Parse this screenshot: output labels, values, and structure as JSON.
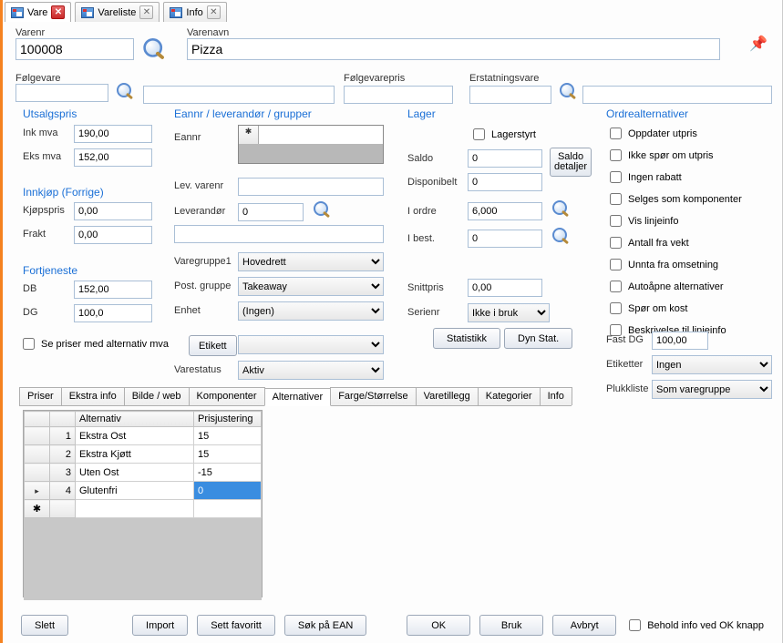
{
  "tabs": [
    {
      "label": "Vare",
      "active": true,
      "close_red": true
    },
    {
      "label": "Vareliste",
      "active": false,
      "close_red": false
    },
    {
      "label": "Info",
      "active": false,
      "close_red": false
    }
  ],
  "header": {
    "varenr_label": "Varenr",
    "varenr_value": "100008",
    "varenavn_label": "Varenavn",
    "varenavn_value": "Pizza",
    "folgevare_label": "Følgevare",
    "folgevarepris_label": "Følgevarepris",
    "erstatningsvare_label": "Erstatningsvare"
  },
  "utsalgspris": {
    "title": "Utsalgspris",
    "ink_mva_label": "Ink mva",
    "ink_mva_value": "190,00",
    "eks_mva_label": "Eks mva",
    "eks_mva_value": "152,00"
  },
  "innkjop": {
    "title": "Innkjøp (Forrige)",
    "kjopspris_label": "Kjøpspris",
    "kjopspris_value": "0,00",
    "frakt_label": "Frakt",
    "frakt_value": "0,00"
  },
  "fortjeneste": {
    "title": "Fortjeneste",
    "db_label": "DB",
    "db_value": "152,00",
    "dg_label": "DG",
    "dg_value": "100,0"
  },
  "alt_mva_label": "Se priser med alternativ mva",
  "ean": {
    "title": "Eannr / leverandør / grupper",
    "eannr_label": "Eannr",
    "lev_varenr_label": "Lev. varenr",
    "leverandor_label": "Leverandør",
    "leverandor_value": "0",
    "varegruppe1_label": "Varegruppe1",
    "varegruppe1_value": "Hovedrett",
    "post_gruppe_label": "Post. gruppe",
    "post_gruppe_value": "Takeaway",
    "enhet_label": "Enhet",
    "enhet_value": "(Ingen)",
    "etikett_label": "Etikett",
    "varestatus_label": "Varestatus",
    "varestatus_value": "Aktiv"
  },
  "lager": {
    "title": "Lager",
    "lagerstyrt_label": "Lagerstyrt",
    "saldo_label": "Saldo",
    "saldo_value": "0",
    "saldo_btn": "Saldo detaljer",
    "disponibelt_label": "Disponibelt",
    "disponibelt_value": "0",
    "iordre_label": "I ordre",
    "iordre_value": "6,000",
    "ibest_label": "I best.",
    "ibest_value": "0",
    "snittpris_label": "Snittpris",
    "snittpris_value": "0,00",
    "serienr_label": "Serienr",
    "serienr_value": "Ikke i bruk",
    "statistikk_btn": "Statistikk",
    "dyn_stat_btn": "Dyn Stat."
  },
  "ordrealt": {
    "title": "Ordrealternativer",
    "opts": [
      "Oppdater utpris",
      "Ikke spør om utpris",
      "Ingen rabatt",
      "Selges som komponenter",
      "Vis linjeinfo",
      "Antall fra vekt",
      "Unnta fra omsetning",
      "Autoåpne alternativer",
      "Spør om kost",
      "Beskrivelse til linjeinfo"
    ],
    "fast_dg_label": "Fast DG",
    "fast_dg_value": "100,00",
    "etiketter_label": "Etiketter",
    "etiketter_value": "Ingen",
    "plukkliste_label": "Plukkliste",
    "plukkliste_value": "Som varegruppe"
  },
  "subtabs": [
    "Priser",
    "Ekstra info",
    "Bilde / web",
    "Komponenter",
    "Alternativer",
    "Farge/Størrelse",
    "Varetillegg",
    "Kategorier",
    "Info"
  ],
  "subtab_active": 4,
  "alt_table": {
    "col_alternativ": "Alternativ",
    "col_pris": "Prisjustering",
    "rows": [
      {
        "n": "1",
        "alt": "Ekstra Ost",
        "pris": "15",
        "sel": false,
        "cursor": false
      },
      {
        "n": "2",
        "alt": "Ekstra Kjøtt",
        "pris": "15",
        "sel": false,
        "cursor": false
      },
      {
        "n": "3",
        "alt": "Uten Ost",
        "pris": "-15",
        "sel": false,
        "cursor": false
      },
      {
        "n": "4",
        "alt": "Glutenfri",
        "pris": "0",
        "sel": true,
        "cursor": true
      }
    ]
  },
  "footer": {
    "slett": "Slett",
    "import": "Import",
    "sett_favoritt": "Sett favoritt",
    "sok_ean": "Søk på EAN",
    "ok": "OK",
    "bruk": "Bruk",
    "avbryt": "Avbryt",
    "behold_info": "Behold info ved OK knapp"
  }
}
